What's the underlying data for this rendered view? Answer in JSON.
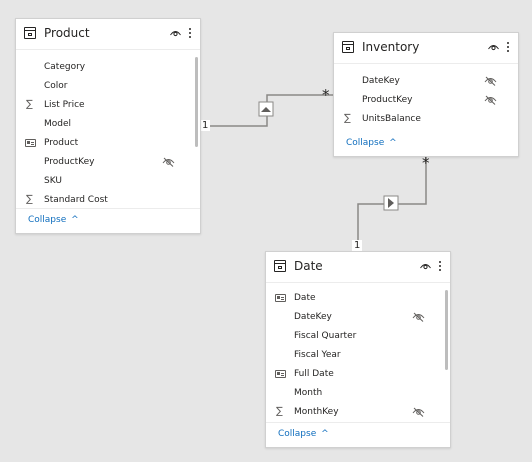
{
  "tables": {
    "product": {
      "title": "Product",
      "fields": [
        {
          "label": "Category"
        },
        {
          "label": "Color"
        },
        {
          "label": "List Price",
          "icon": "sigma-icon"
        },
        {
          "label": "Model"
        },
        {
          "label": "Product",
          "icon": "text-field-icon"
        },
        {
          "label": "ProductKey",
          "hidden": true
        },
        {
          "label": "SKU"
        },
        {
          "label": "Standard Cost",
          "icon": "sigma-icon"
        }
      ],
      "collapse_label": "Collapse"
    },
    "inventory": {
      "title": "Inventory",
      "fields": [
        {
          "label": "DateKey",
          "hidden": true
        },
        {
          "label": "ProductKey",
          "hidden": true
        },
        {
          "label": "UnitsBalance",
          "icon": "sigma-icon"
        }
      ],
      "collapse_label": "Collapse"
    },
    "date": {
      "title": "Date",
      "fields": [
        {
          "label": "Date",
          "icon": "text-field-icon"
        },
        {
          "label": "DateKey",
          "hidden": true
        },
        {
          "label": "Fiscal Quarter"
        },
        {
          "label": "Fiscal Year"
        },
        {
          "label": "Full Date",
          "icon": "text-field-icon"
        },
        {
          "label": "Month"
        },
        {
          "label": "MonthKey",
          "icon": "sigma-icon",
          "hidden": true
        }
      ],
      "collapse_label": "Collapse"
    }
  },
  "relationships": {
    "product_inventory": {
      "from_cardinality": "1",
      "to_cardinality": "*"
    },
    "date_inventory": {
      "from_cardinality": "1",
      "to_cardinality": "*"
    }
  },
  "colors": {
    "canvas": "#e6e6e6",
    "link": "#106ebe",
    "text": "#252423",
    "line": "#8a8886"
  }
}
